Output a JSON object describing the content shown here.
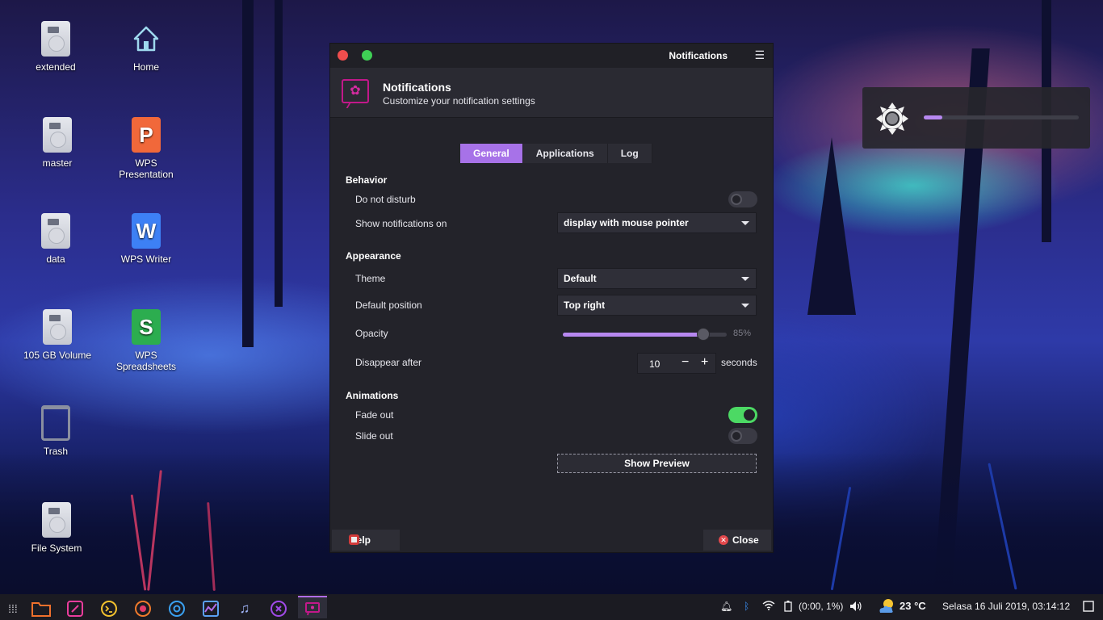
{
  "desktop": {
    "icons": [
      {
        "label": "extended"
      },
      {
        "label": "master"
      },
      {
        "label": "data"
      },
      {
        "label": "105 GB Volume"
      },
      {
        "label": "Trash"
      },
      {
        "label": "File System"
      },
      {
        "label": "Home"
      },
      {
        "label": "WPS\nPresentation"
      },
      {
        "label": "WPS Writer"
      },
      {
        "label": "WPS\nSpreadsheets"
      }
    ]
  },
  "osd": {
    "icon": "brightness-icon",
    "level": 0.12
  },
  "window": {
    "title": "Notifications",
    "header": {
      "title": "Notifications",
      "subtitle": "Customize your notification settings"
    },
    "tabs": [
      {
        "label": "General"
      },
      {
        "label": "Applications"
      },
      {
        "label": "Log"
      }
    ],
    "behavior": {
      "section": "Behavior",
      "dnd_label": "Do not disturb",
      "dnd_on": false,
      "show_on_label": "Show notifications on",
      "show_on_value": "display with mouse pointer"
    },
    "appearance": {
      "section": "Appearance",
      "theme_label": "Theme",
      "theme_value": "Default",
      "position_label": "Default position",
      "position_value": "Top right",
      "opacity_label": "Opacity",
      "opacity_value": "85%",
      "opacity_level": 85,
      "disappear_label": "Disappear after",
      "disappear_value": "10",
      "disappear_unit": "seconds"
    },
    "animations": {
      "section": "Animations",
      "fade_label": "Fade out",
      "fade_on": true,
      "slide_label": "Slide out",
      "slide_on": false
    },
    "preview_label": "Show Preview",
    "help_label": "Help",
    "close_label": "Close"
  },
  "taskbar": {
    "apps": [
      "app-grid-icon",
      "files-icon",
      "text-editor-icon",
      "terminal-icon",
      "firefox-icon",
      "chrome-icon",
      "system-monitor-icon",
      "music-icon",
      "visual-studio-code-icon",
      "notifications-icon"
    ],
    "battery_text": "(0:00, 1%)",
    "temperature": "23 °C",
    "clock": "Selasa 16 Juli 2019, 03:14:12"
  }
}
